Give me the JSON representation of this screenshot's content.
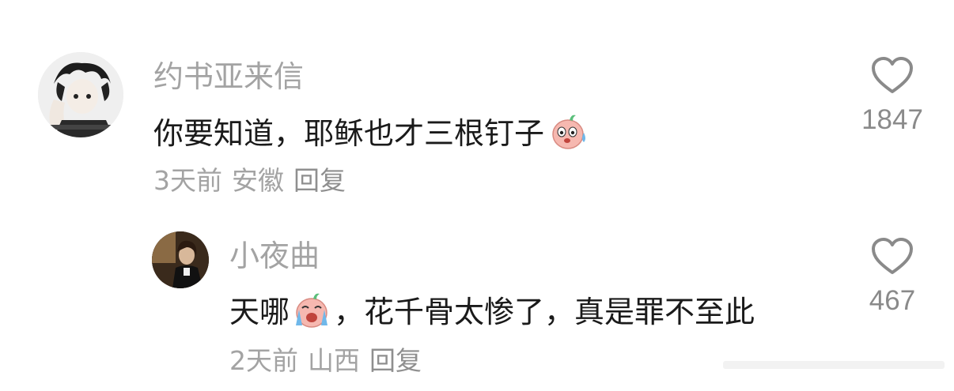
{
  "comments": [
    {
      "username": "约书亚来信",
      "text_before": "你要知道，耶稣也才三根钉子",
      "text_after": "",
      "emoji": "sweating-face-emoji",
      "time": "3天前",
      "location": "安徽",
      "reply_label": "回复",
      "likes": "1847"
    },
    {
      "username": "小夜曲",
      "text_before": "天哪",
      "text_after": "，花千骨太惨了，真是罪不至此",
      "emoji": "crying-face-emoji",
      "time": "2天前",
      "location": "山西",
      "reply_label": "回复",
      "likes": "467"
    }
  ],
  "colors": {
    "username": "#a3a3a3",
    "text": "#1a1a1a",
    "meta": "#a3a3a3",
    "icon": "#8a8a8a",
    "emoji_body": "#f6b8b0"
  }
}
